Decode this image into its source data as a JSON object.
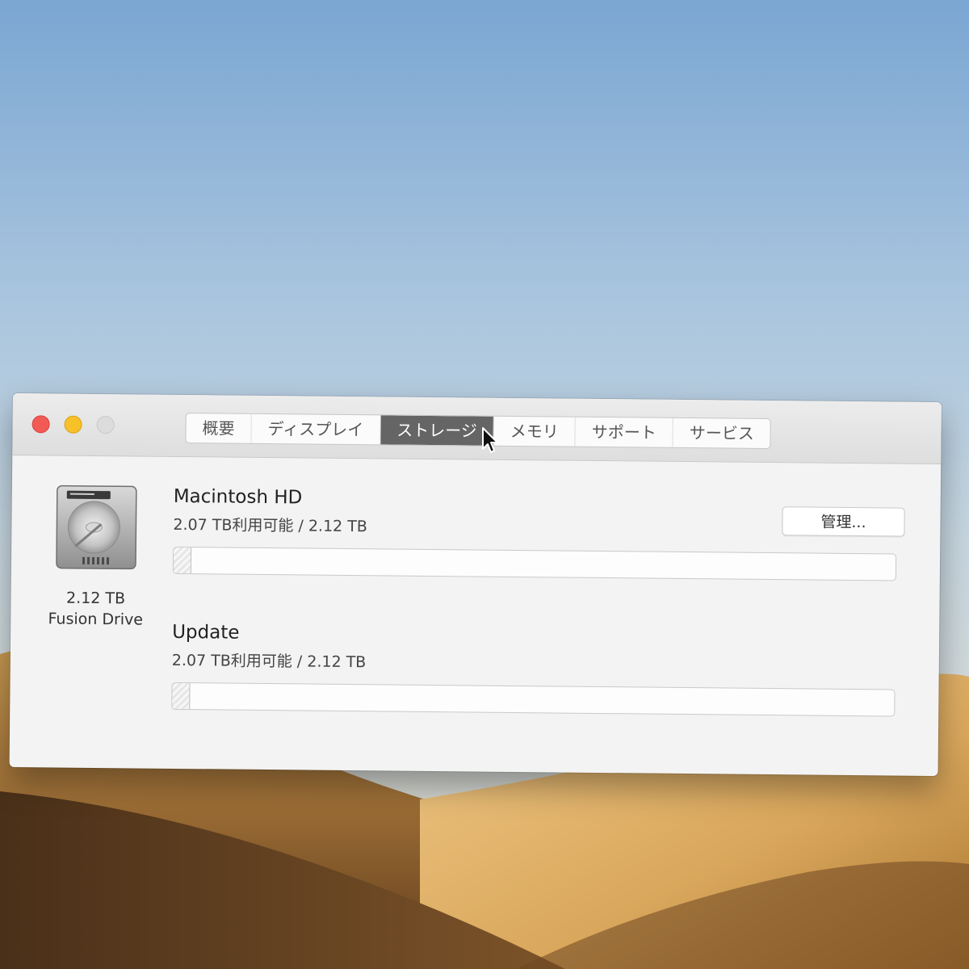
{
  "window": {
    "tabs": [
      {
        "label": "概要",
        "selected": false
      },
      {
        "label": "ディスプレイ",
        "selected": false
      },
      {
        "label": "ストレージ",
        "selected": true
      },
      {
        "label": "メモリ",
        "selected": false
      },
      {
        "label": "サポート",
        "selected": false
      },
      {
        "label": "サービス",
        "selected": false
      }
    ]
  },
  "drive": {
    "icon": "hard-drive-icon",
    "size": "2.12 TB",
    "kind": "Fusion Drive"
  },
  "manage_button": {
    "label": "管理..."
  },
  "volumes": [
    {
      "name": "Macintosh HD",
      "usage": "2.07 TB利用可能 / 2.12 TB",
      "used_fraction": 0.023
    },
    {
      "name": "Update",
      "usage": "2.07 TB利用可能 / 2.12 TB",
      "used_fraction": 0.023
    }
  ],
  "colors": {
    "close": "#f25a55",
    "minimize": "#f7c12a",
    "zoom": "#dcdcdc",
    "selected_tab": "#656565"
  }
}
